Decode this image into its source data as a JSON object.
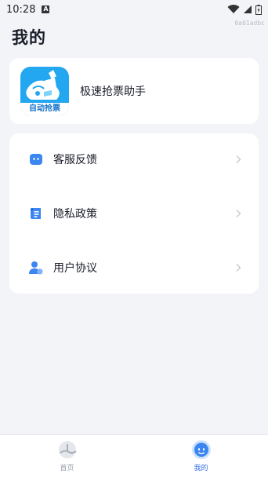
{
  "status_bar": {
    "time": "10:28",
    "notification_icon": "A",
    "device_id": "0a01adbc"
  },
  "header": {
    "title": "我的"
  },
  "app_card": {
    "logo_text": "自动抢票",
    "name": "极速抢票助手"
  },
  "menu": {
    "items": [
      {
        "label": "客服反馈",
        "icon": "customer-service-icon"
      },
      {
        "label": "隐私政策",
        "icon": "privacy-policy-icon"
      },
      {
        "label": "用户协议",
        "icon": "user-agreement-icon"
      }
    ]
  },
  "tab_bar": {
    "tabs": [
      {
        "label": "首页",
        "icon": "home-icon",
        "active": false
      },
      {
        "label": "我的",
        "icon": "profile-icon",
        "active": true
      }
    ]
  },
  "colors": {
    "accent": "#2f6fe6",
    "logo_bg": "#22a7f0",
    "background": "#f3f4f8"
  }
}
